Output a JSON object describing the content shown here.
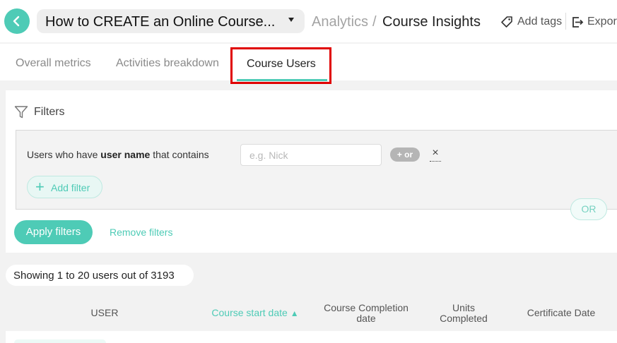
{
  "header": {
    "course_title": "How to CREATE an Online Course...",
    "breadcrumb_parent": "Analytics",
    "breadcrumb_separator": "/",
    "breadcrumb_current": "Course Insights",
    "add_tags_label": "Add tags",
    "export_label": "Export"
  },
  "tabs": [
    {
      "label": "Overall metrics"
    },
    {
      "label": "Activities breakdown"
    },
    {
      "label": "Course Users",
      "active": true
    }
  ],
  "filters": {
    "title": "Filters",
    "rule_prefix": "Users who  have ",
    "rule_field": "user name",
    "rule_operator": " that contains",
    "input_value": "",
    "input_placeholder": "e.g. Nick",
    "or_pill_label": "+ or",
    "remove_rule_symbol": "×",
    "add_filter_symbol": "+",
    "add_filter_label": "Add filter",
    "or_group_label": "OR",
    "apply_label": "Apply filters",
    "remove_label": "Remove filters"
  },
  "results": {
    "showing_text": "Showing 1 to 20 users out of 3193"
  },
  "table": {
    "columns": [
      {
        "label": "USER"
      },
      {
        "label": "Course start date",
        "sort_arrow": "▲"
      },
      {
        "label": "Course Completion date"
      },
      {
        "label": "Units Completed"
      },
      {
        "label": "Certificate Date"
      }
    ]
  },
  "colors": {
    "accent": "#4ecbb6",
    "highlight_border": "#e00000",
    "muted_text": "#a3a3a3"
  },
  "icons": {
    "back": "chevron-left-icon",
    "caret": "caret-down-icon",
    "tag": "tag-icon",
    "export": "export-icon",
    "filter": "funnel-icon"
  }
}
